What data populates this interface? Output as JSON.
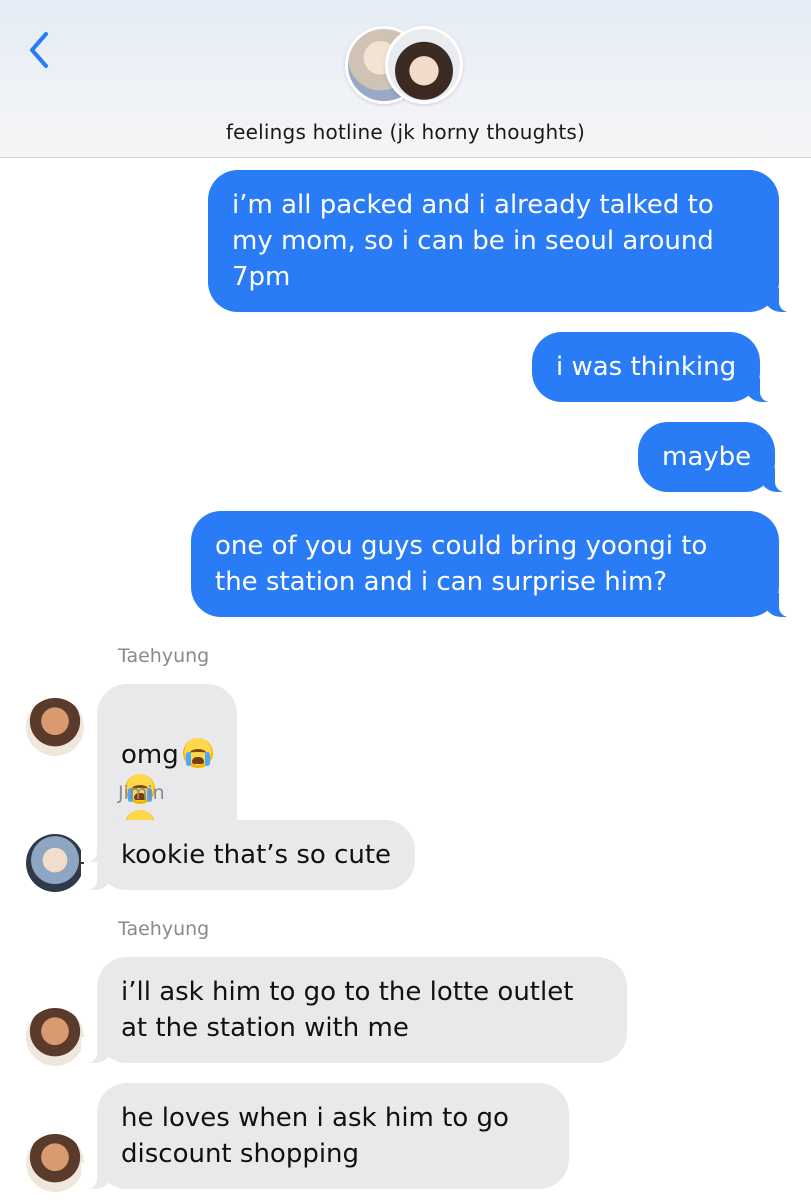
{
  "header": {
    "title": "feelings hotline (jk horny thoughts)",
    "back_icon": "chevron-left-icon",
    "accent": "#2a7cf6"
  },
  "messages": [
    {
      "from": "me",
      "text": "i’m all packed and i already talked to\nmy mom, so i can be in seoul around\n7pm"
    },
    {
      "from": "me",
      "text": "i was thinking"
    },
    {
      "from": "me",
      "text": "maybe"
    },
    {
      "from": "me",
      "text": "one of you guys could bring yoongi to\nthe station and i can surprise him?"
    },
    {
      "from": "Taehyung",
      "sender_label": "Taehyung",
      "text": "omg",
      "emoji": "loudly-crying-face-emoji",
      "emoji_count": 3
    },
    {
      "from": "Jimin",
      "sender_label": "Jimin",
      "text": "kookie that’s so cute"
    },
    {
      "from": "Taehyung",
      "sender_label": "Taehyung",
      "text": "i’ll ask him to go to the lotte outlet\nat the station with me"
    },
    {
      "from": "Taehyung",
      "text": "he loves when i ask him to go\ndiscount shopping"
    }
  ],
  "colors": {
    "outgoing_bubble": "#2a7cf6",
    "incoming_bubble": "#e9e9eb",
    "sender_label": "#8a8a8e"
  }
}
